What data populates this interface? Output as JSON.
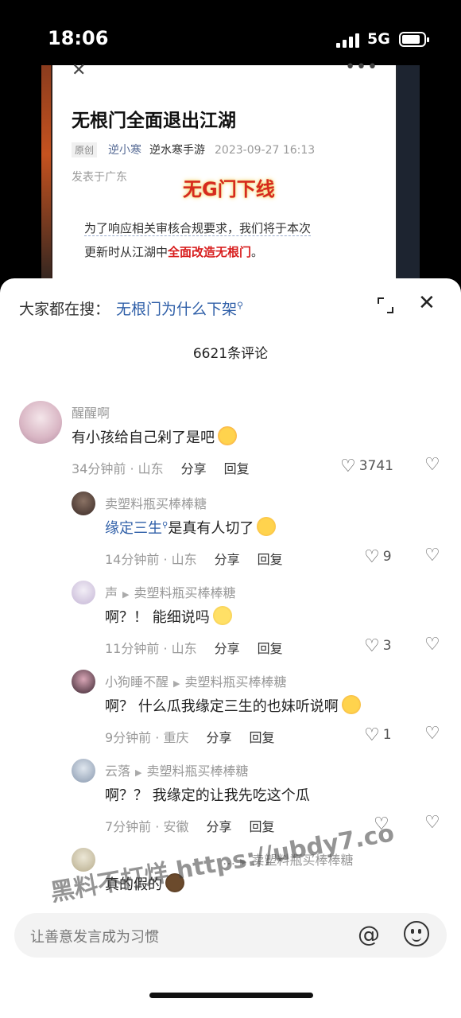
{
  "status_bar": {
    "time": "18:06",
    "network": "5G"
  },
  "article": {
    "title": "无根门全面退出江湖",
    "original_tag": "原创",
    "author": "逆小寒",
    "account": "逆水寒手游",
    "datetime": "2023-09-27 16:13",
    "location": "发表于广东",
    "banner": "无G门下线",
    "body_line1": "为了响应相关审核合规要求，我们将于本次",
    "body_line2_pre": "更新时从江湖中",
    "body_line2_hl": "全面改造无根门",
    "body_line2_post": "。"
  },
  "sheet": {
    "search_prefix": "大家都在搜：",
    "search_keyword": "无根门为什么下架",
    "comment_count": "6621条评论"
  },
  "comments": [
    {
      "name": "醒醒啊",
      "text": "有小孩给自己剁了是吧",
      "time_loc": "34分钟前 · 山东",
      "share": "分享",
      "reply": "回复",
      "likes": "3741"
    },
    {
      "name": "卖塑料瓶买棒棒糖",
      "link": "缘定三生",
      "text": "是真有人切了",
      "time_loc": "14分钟前 · 山东",
      "share": "分享",
      "reply": "回复",
      "likes": "9"
    },
    {
      "name": "声",
      "reply_to": "卖塑料瓶买棒棒糖",
      "text": "啊？！ 能细说吗",
      "time_loc": "11分钟前 · 山东",
      "share": "分享",
      "reply": "回复",
      "likes": "3"
    },
    {
      "name": "小狗睡不醒",
      "reply_to": "卖塑料瓶买棒棒糖",
      "text": "啊？ 什么瓜我缘定三生的也妹听说啊",
      "time_loc": "9分钟前 · 重庆",
      "share": "分享",
      "reply": "回复",
      "likes": "1"
    },
    {
      "name": "云落",
      "reply_to": "卖塑料瓶买棒棒糖",
      "text": "啊？？ 我缘定的让我先吃这个瓜",
      "time_loc": "7分钟前 · 安徽",
      "share": "分享",
      "reply": "回复",
      "likes": ""
    },
    {
      "name": "…",
      "reply_to": "卖塑料瓶买棒棒糖",
      "text": "真的假的"
    }
  ],
  "watermark": "黑料不打烊 https://ubdy7.co",
  "input": {
    "placeholder": "让善意发言成为习惯"
  },
  "colors": {
    "link": "#2f5fa8",
    "highlight": "#d81e1e"
  }
}
